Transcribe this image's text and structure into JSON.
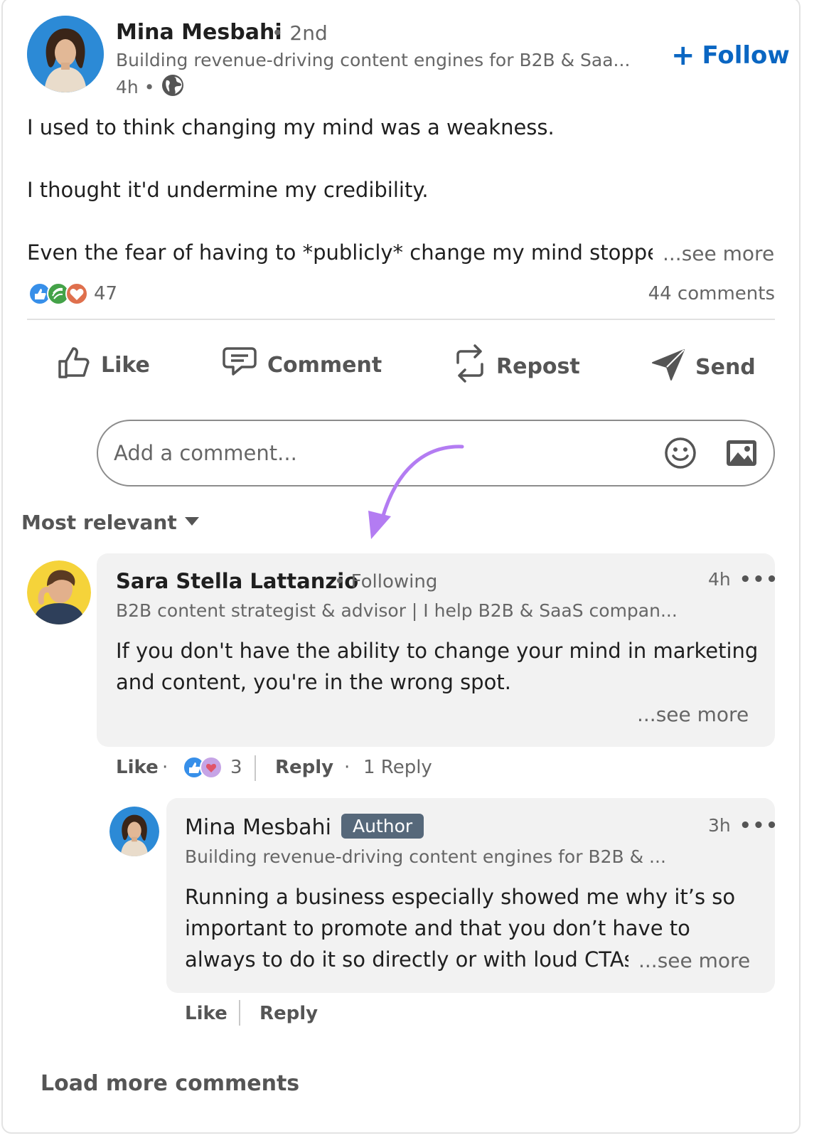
{
  "post": {
    "author_name": "Mina Mesbahi",
    "degree": "• 2nd",
    "headline": "Building revenue-driving content engines for B2B & Saa...",
    "time": "4h •",
    "follow_label": "Follow",
    "lines": [
      "I used to think changing my mind was a weakness.",
      "I thought it'd undermine my credibility.",
      "Even the fear of having to *publicly* change my mind stopped"
    ],
    "see_more": "...see more",
    "reactions_count": "47",
    "comments_count": "44 comments"
  },
  "actions": {
    "like": "Like",
    "comment": "Comment",
    "repost": "Repost",
    "send": "Send"
  },
  "composer": {
    "placeholder": "Add a comment..."
  },
  "sort": {
    "label": "Most relevant"
  },
  "comment1": {
    "name": "Sara Stella Lattanzio",
    "relation": "• Following",
    "headline": "B2B content strategist & advisor | I help B2B & SaaS compan...",
    "time": "4h",
    "more": "•••",
    "lines": [
      "If you don't have the ability to change your mind in marketing",
      "and content, you're in the wrong spot."
    ],
    "see_more": "...see more",
    "like": "Like",
    "sep": "·",
    "reactions": "3",
    "reply": "Reply",
    "sep2": "·",
    "replies": "1 Reply"
  },
  "reply1": {
    "name": "Mina Mesbahi",
    "badge": "Author",
    "headline": "Building revenue-driving content engines for B2B & ...",
    "time": "3h",
    "more": "•••",
    "lines": [
      "Running a business especially showed me why it’s so",
      "important to promote and that you don’t have to",
      "always to do it so directly or with loud CTAs"
    ],
    "see_more": "...see more",
    "like": "Like",
    "reply": "Reply"
  },
  "footer": {
    "load_more": "Load more comments"
  },
  "colors": {
    "brand_blue": "#0a66c2",
    "annotation_purple": "#b37cf2",
    "author_badge": "#56687a"
  }
}
